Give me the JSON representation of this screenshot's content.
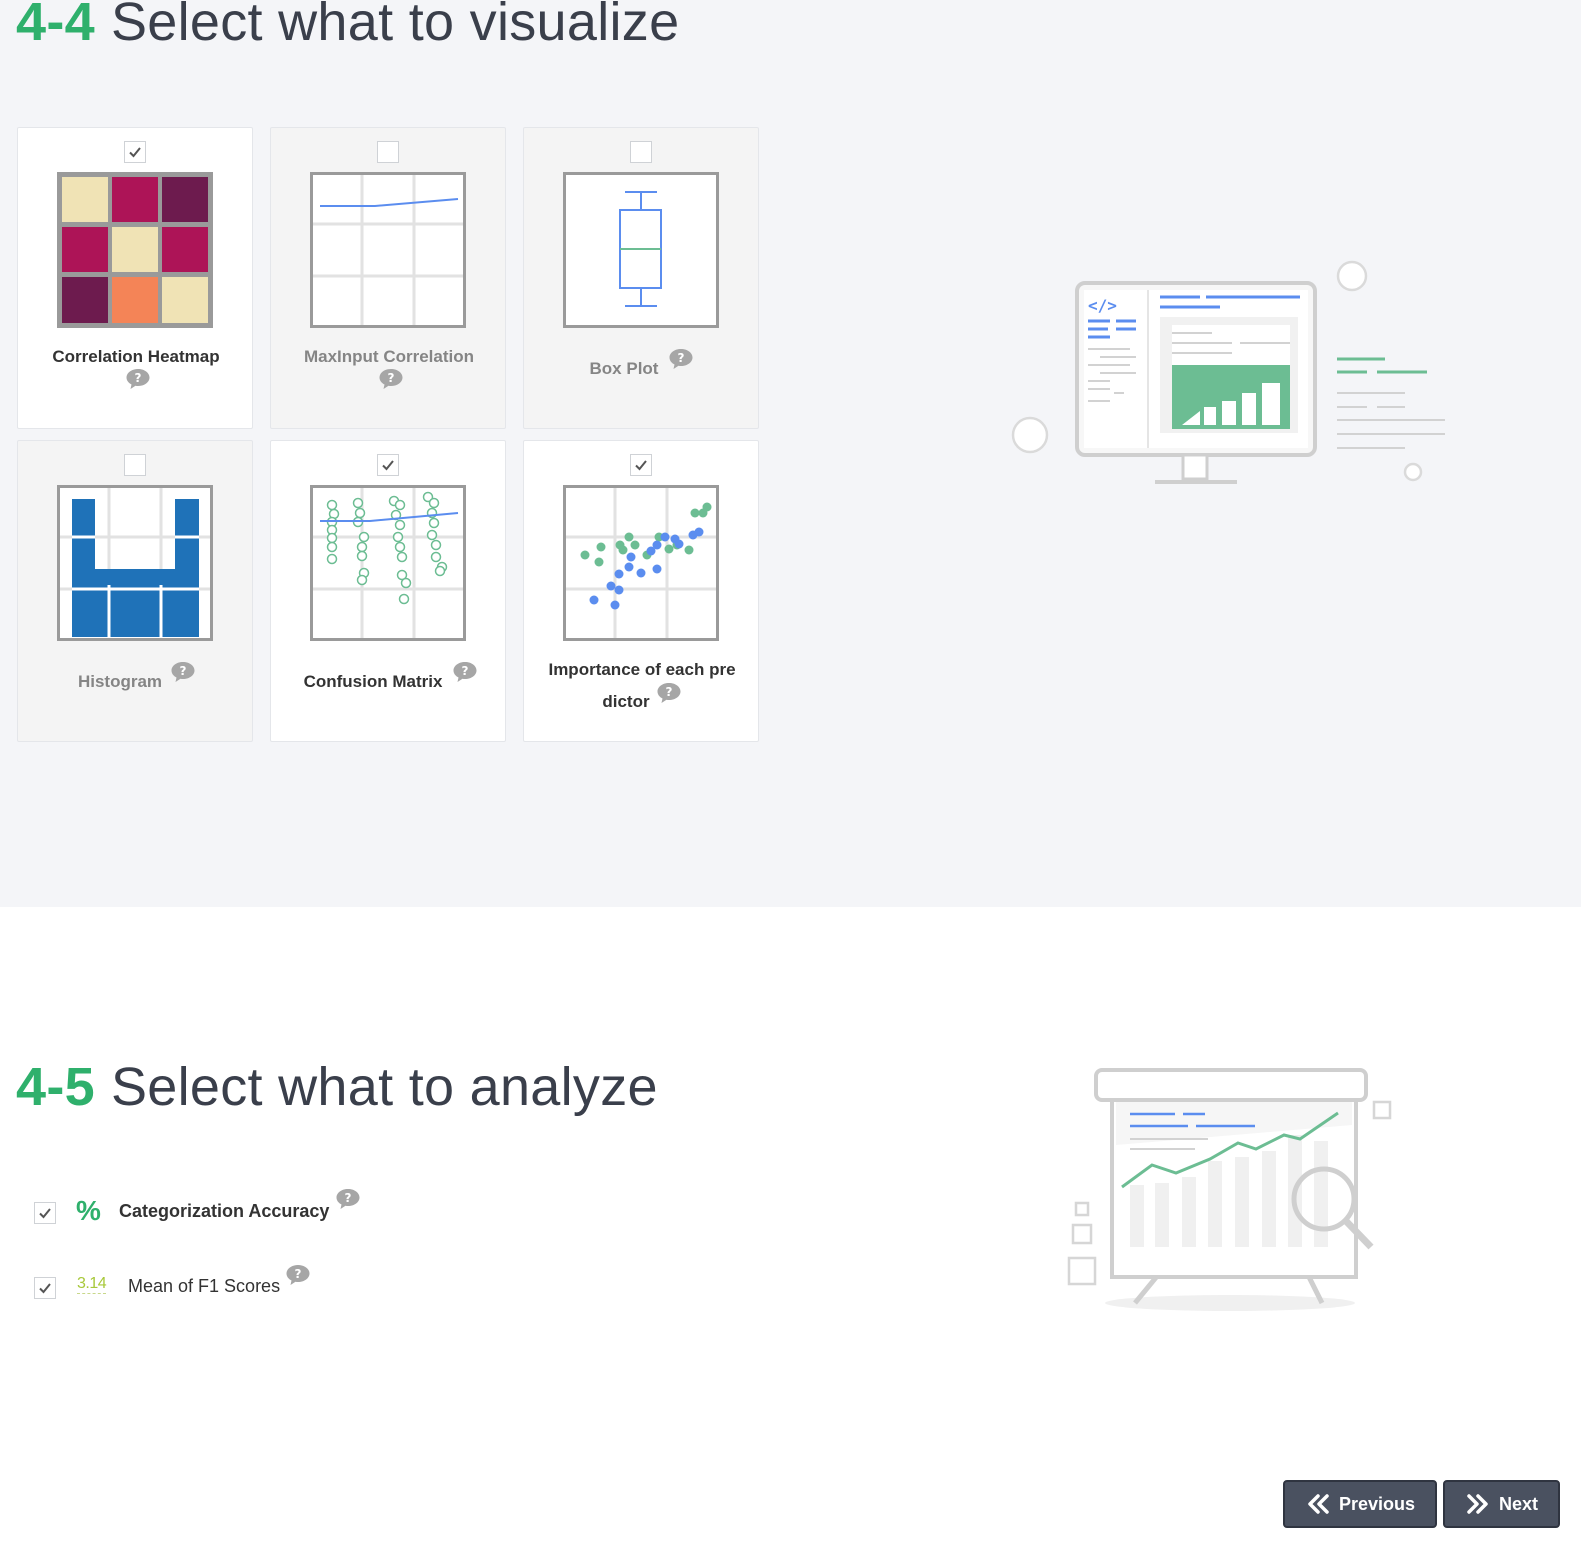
{
  "visualize": {
    "number": "4-4",
    "title": "Select what to visualize",
    "cards": [
      {
        "label": "Correlation Heatmap",
        "checked": true
      },
      {
        "label": "MaxInput Correlation",
        "checked": false
      },
      {
        "label": "Box Plot",
        "checked": false
      },
      {
        "label": "Histogram",
        "checked": false
      },
      {
        "label": "Confusion Matrix",
        "checked": true
      },
      {
        "label_line1": "Importance of each pre",
        "label_line2": "dictor",
        "checked": true
      }
    ]
  },
  "analyze": {
    "number": "4-5",
    "title": "Select what to analyze",
    "items": [
      {
        "icon_text": "%",
        "label": "Categorization Accuracy",
        "checked": true
      },
      {
        "icon_text": "3.14",
        "label": "Mean of F1 Scores",
        "checked": true
      }
    ]
  },
  "nav": {
    "previous_label": "Previous",
    "next_label": "Next"
  },
  "colors": {
    "accent": "#2fb06c",
    "button": "#4a5160",
    "blue": "#5b8def",
    "green": "#6cbd93"
  }
}
